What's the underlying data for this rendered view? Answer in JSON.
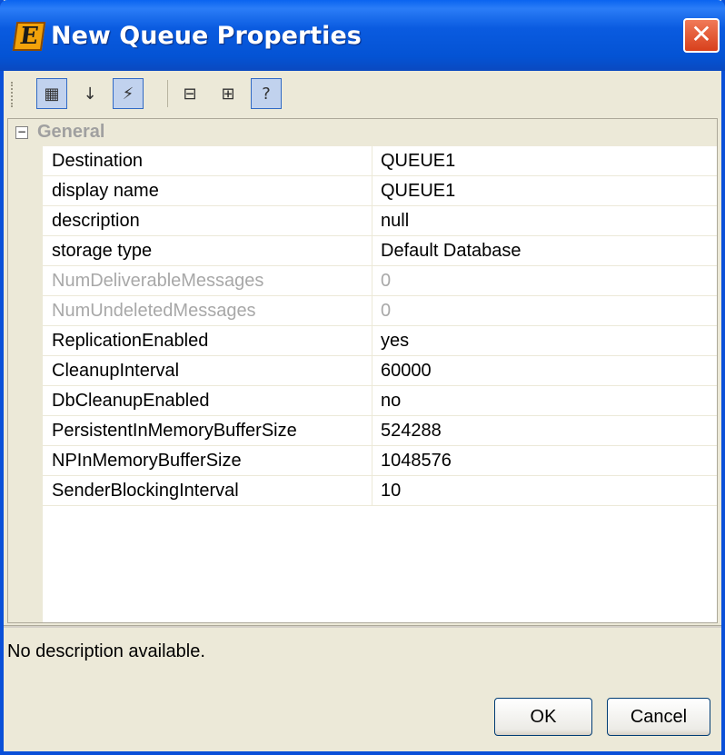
{
  "window": {
    "title": "New Queue Properties",
    "app_icon_letter": "E",
    "close_symbol": "✕"
  },
  "toolbar": {
    "buttons": [
      {
        "name": "categorized-view-icon",
        "glyph": "▦",
        "pressed": true
      },
      {
        "name": "sort-alphabetical-icon",
        "glyph": "↓",
        "pressed": false
      },
      {
        "name": "lightning-icon",
        "glyph": "⚡",
        "pressed": true
      },
      {
        "name": "collapse-all-icon",
        "glyph": "⊟",
        "pressed": false
      },
      {
        "name": "expand-all-icon",
        "glyph": "⊞",
        "pressed": false
      },
      {
        "name": "help-description-icon",
        "glyph": "?",
        "pressed": true
      }
    ]
  },
  "property_grid": {
    "category": {
      "label": "General",
      "toggle": "−"
    },
    "rows": [
      {
        "name": "Destination",
        "value": "QUEUE1",
        "disabled": false
      },
      {
        "name": "display name",
        "value": "QUEUE1",
        "disabled": false
      },
      {
        "name": "description",
        "value": "null",
        "disabled": false
      },
      {
        "name": "storage type",
        "value": "Default Database",
        "disabled": false
      },
      {
        "name": "NumDeliverableMessages",
        "value": "0",
        "disabled": true
      },
      {
        "name": "NumUndeletedMessages",
        "value": "0",
        "disabled": true
      },
      {
        "name": "ReplicationEnabled",
        "value": "yes",
        "disabled": false
      },
      {
        "name": "CleanupInterval",
        "value": "60000",
        "disabled": false
      },
      {
        "name": "DbCleanupEnabled",
        "value": "no",
        "disabled": false
      },
      {
        "name": "PersistentInMemoryBufferSize",
        "value": "524288",
        "disabled": false
      },
      {
        "name": "NPInMemoryBufferSize",
        "value": "1048576",
        "disabled": false
      },
      {
        "name": "SenderBlockingInterval",
        "value": "10",
        "disabled": false
      }
    ]
  },
  "description_panel": {
    "text": "No description available."
  },
  "buttons": {
    "ok_label": "OK",
    "cancel_label": "Cancel"
  },
  "colors": {
    "titlebar": "#0a5be0",
    "close": "#d8401c",
    "background": "#ece9d8"
  }
}
